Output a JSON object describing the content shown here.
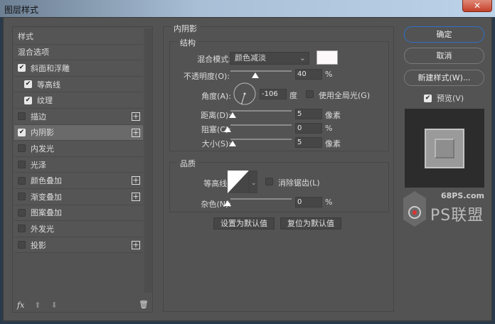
{
  "window": {
    "title": "图层样式",
    "close": "✕"
  },
  "sidebar": {
    "items": [
      {
        "label": "样式",
        "checkbox": null,
        "plus": false
      },
      {
        "label": "混合选项",
        "checkbox": null,
        "plus": false
      },
      {
        "label": "斜面和浮雕",
        "checkbox": true,
        "plus": false
      },
      {
        "label": "等高线",
        "checkbox": true,
        "plus": false,
        "indent": true
      },
      {
        "label": "纹理",
        "checkbox": true,
        "plus": false,
        "indent": true
      },
      {
        "label": "描边",
        "checkbox": false,
        "plus": true
      },
      {
        "label": "内阴影",
        "checkbox": true,
        "plus": true,
        "active": true
      },
      {
        "label": "内发光",
        "checkbox": false,
        "plus": false
      },
      {
        "label": "光泽",
        "checkbox": false,
        "plus": false
      },
      {
        "label": "颜色叠加",
        "checkbox": false,
        "plus": true
      },
      {
        "label": "渐变叠加",
        "checkbox": false,
        "plus": true
      },
      {
        "label": "图案叠加",
        "checkbox": false,
        "plus": false
      },
      {
        "label": "外发光",
        "checkbox": false,
        "plus": false
      },
      {
        "label": "投影",
        "checkbox": false,
        "plus": true
      }
    ],
    "footer": {
      "fx": "fx"
    }
  },
  "panel": {
    "title": "内阴影",
    "structure": {
      "title": "结构",
      "blend_mode_label": "混合模式:",
      "blend_mode": "颜色减淡",
      "color": "#fdf9fa",
      "opacity_label": "不透明度(O):",
      "opacity": "40",
      "opacity_unit": "%",
      "angle_label": "角度(A):",
      "angle": "-106",
      "angle_unit": "度",
      "global_light": "使用全局光(G)",
      "global_light_checked": false,
      "distance_label": "距离(D):",
      "distance": "5",
      "distance_unit": "像素",
      "choke_label": "阻塞(C):",
      "choke": "0",
      "choke_unit": "%",
      "size_label": "大小(S):",
      "size": "5",
      "size_unit": "像素"
    },
    "quality": {
      "title": "品质",
      "contour_label": "等高线:",
      "antialias": "消除锯齿(L)",
      "antialias_checked": false,
      "noise_label": "杂色(N):",
      "noise": "0",
      "noise_unit": "%"
    },
    "set_default": "设置为默认值",
    "reset_default": "复位为默认值"
  },
  "actions": {
    "ok": "确定",
    "cancel": "取消",
    "new_style": "新建样式(W)...",
    "preview": "预览(V)",
    "preview_checked": true
  },
  "watermark": {
    "site": "68PS.com",
    "brand": "PS联盟"
  }
}
